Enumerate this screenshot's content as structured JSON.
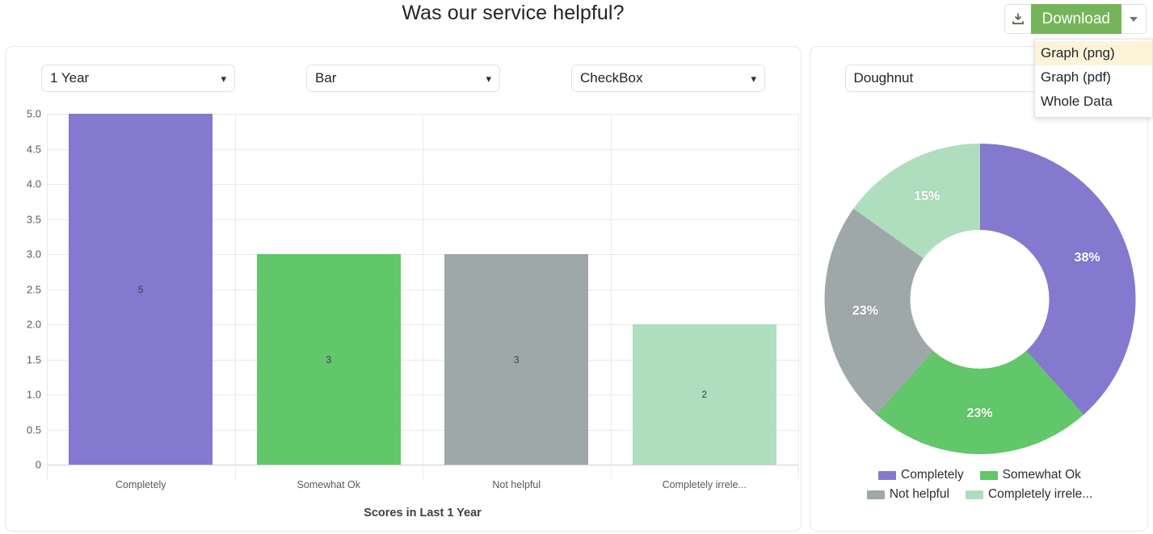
{
  "header": {
    "title": "Was our service helpful?",
    "download_button": "Download",
    "download_icon": "download-icon",
    "caret_icon": "chevron-down-icon",
    "menu": [
      {
        "label": "Graph (png)",
        "active": true
      },
      {
        "label": "Graph (pdf)",
        "active": false
      },
      {
        "label": "Whole Data",
        "active": false
      }
    ]
  },
  "left_panel": {
    "controls": [
      {
        "name": "period-select",
        "value": "1 Year"
      },
      {
        "name": "chart-type-select",
        "value": "Bar"
      },
      {
        "name": "question-type-select",
        "value": "CheckBox"
      }
    ]
  },
  "right_panel": {
    "controls": [
      {
        "name": "chart-type-select",
        "value": "Doughnut"
      }
    ]
  },
  "colors": {
    "completely": "#8479ce",
    "somewhat_ok": "#61c76a",
    "not_helpful": "#9ea8a9",
    "completely_irrelevant": "#aedebe",
    "download_green": "#74b55a",
    "menu_highlight": "#fdf3d8",
    "grid": "#e9e9ea"
  },
  "chart_data": [
    {
      "type": "bar",
      "title": "",
      "categories": [
        "Completely",
        "Somewhat Ok",
        "Not helpful",
        "Completely irrele..."
      ],
      "values": [
        5,
        3,
        3,
        2
      ],
      "value_labels": [
        "5",
        "3",
        "3",
        "2"
      ],
      "colors": [
        "#8479ce",
        "#61c76a",
        "#9ea8a9",
        "#aedebe"
      ],
      "xlabel": "Scores in Last 1 Year",
      "ylabel": "",
      "ylim": [
        0,
        5
      ],
      "yticks": [
        "0",
        "0.5",
        "1.0",
        "1.5",
        "2.0",
        "2.5",
        "3.0",
        "3.5",
        "4.0",
        "4.5",
        "5.0"
      ],
      "ytick_values": [
        0,
        0.5,
        1,
        1.5,
        2,
        2.5,
        3,
        3.5,
        4,
        4.5,
        5
      ],
      "grid": true,
      "legend": "none"
    },
    {
      "type": "pie",
      "variant": "doughnut",
      "title": "",
      "labels": [
        "Completely",
        "Somewhat Ok",
        "Not helpful",
        "Completely irrele..."
      ],
      "values": [
        38,
        23,
        23,
        15
      ],
      "slice_labels": [
        "38%",
        "23%",
        "23%",
        "15%"
      ],
      "colors": [
        "#8479ce",
        "#61c76a",
        "#9ea8a9",
        "#aedebe"
      ],
      "legend": "bottom",
      "start_angle": 0
    }
  ]
}
